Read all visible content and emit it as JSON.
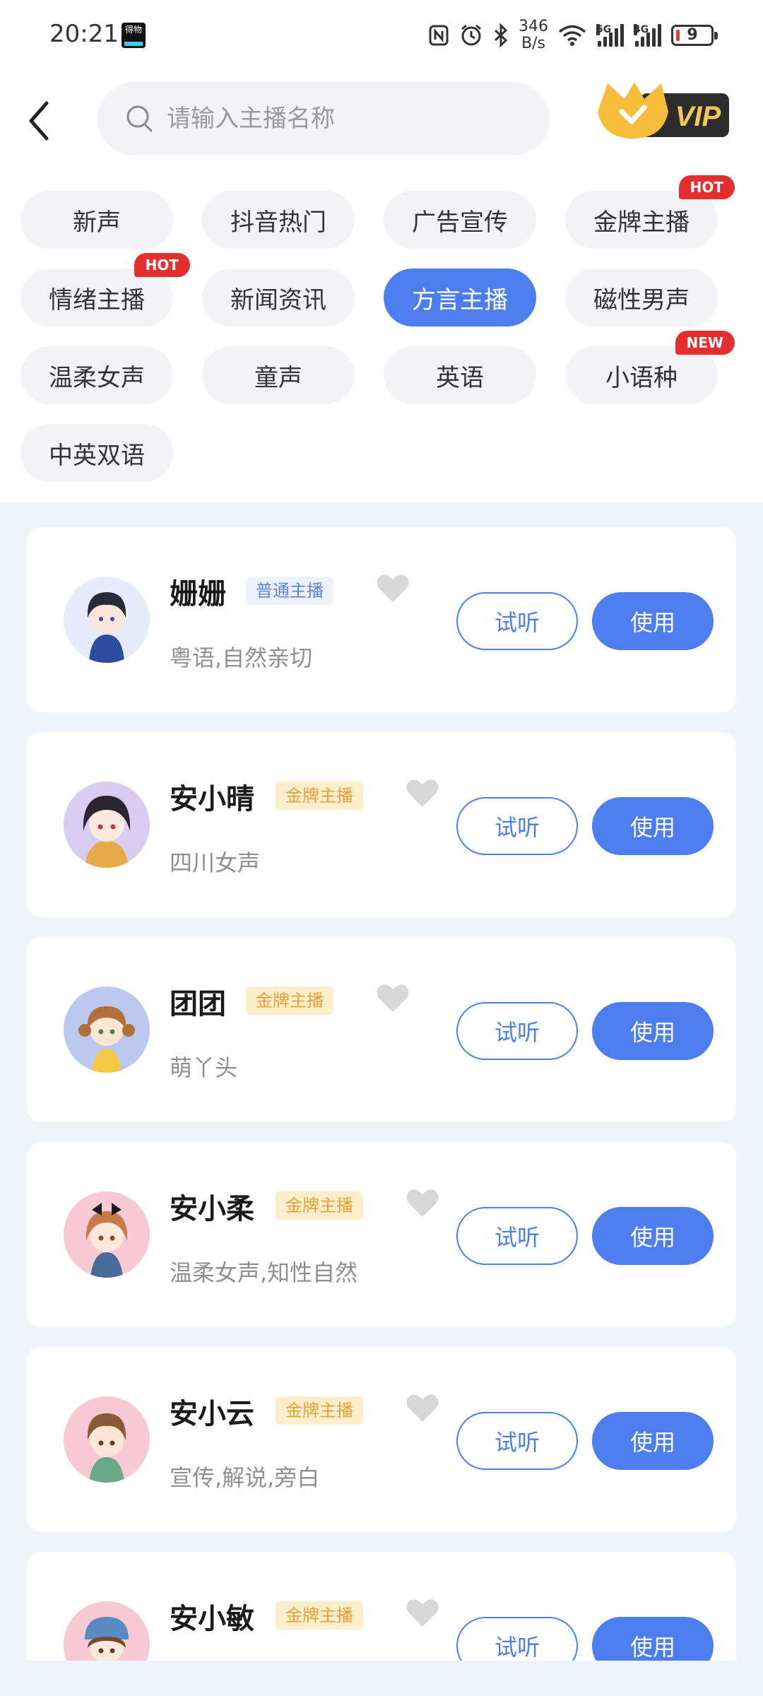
{
  "status": {
    "time": "20:21",
    "app_icon_text": "得物",
    "speed_value": "346",
    "speed_unit": "B/s",
    "sim1_label": "5G",
    "sim2_label": "4G",
    "battery": "9"
  },
  "header": {
    "search_placeholder": "请输入主播名称",
    "vip_label": "VIP"
  },
  "tags": [
    {
      "label": "新声",
      "badge": "",
      "active": false
    },
    {
      "label": "抖音热门",
      "badge": "",
      "active": false
    },
    {
      "label": "广告宣传",
      "badge": "",
      "active": false
    },
    {
      "label": "金牌主播",
      "badge": "HOT",
      "active": false
    },
    {
      "label": "情绪主播",
      "badge": "HOT",
      "active": false
    },
    {
      "label": "新闻资讯",
      "badge": "",
      "active": false
    },
    {
      "label": "方言主播",
      "badge": "",
      "active": true
    },
    {
      "label": "磁性男声",
      "badge": "",
      "active": false
    },
    {
      "label": "温柔女声",
      "badge": "",
      "active": false
    },
    {
      "label": "童声",
      "badge": "",
      "active": false
    },
    {
      "label": "英语",
      "badge": "",
      "active": false
    },
    {
      "label": "小语种",
      "badge": "NEW",
      "active": false
    },
    {
      "label": "中英双语",
      "badge": "",
      "active": false
    }
  ],
  "buttons": {
    "try_label": "试听",
    "use_label": "使用"
  },
  "anchors": [
    {
      "name": "姗姗",
      "level": "普通主播",
      "level_type": "normal",
      "desc": "粤语,自然亲切"
    },
    {
      "name": "安小晴",
      "level": "金牌主播",
      "level_type": "gold",
      "desc": "四川女声"
    },
    {
      "name": "团团",
      "level": "金牌主播",
      "level_type": "gold",
      "desc": "萌丫头"
    },
    {
      "name": "安小柔",
      "level": "金牌主播",
      "level_type": "gold",
      "desc": "温柔女声,知性自然"
    },
    {
      "name": "安小云",
      "level": "金牌主播",
      "level_type": "gold",
      "desc": "宣传,解说,旁白"
    },
    {
      "name": "安小敏",
      "level": "金牌主播",
      "level_type": "gold",
      "desc": ""
    }
  ]
}
